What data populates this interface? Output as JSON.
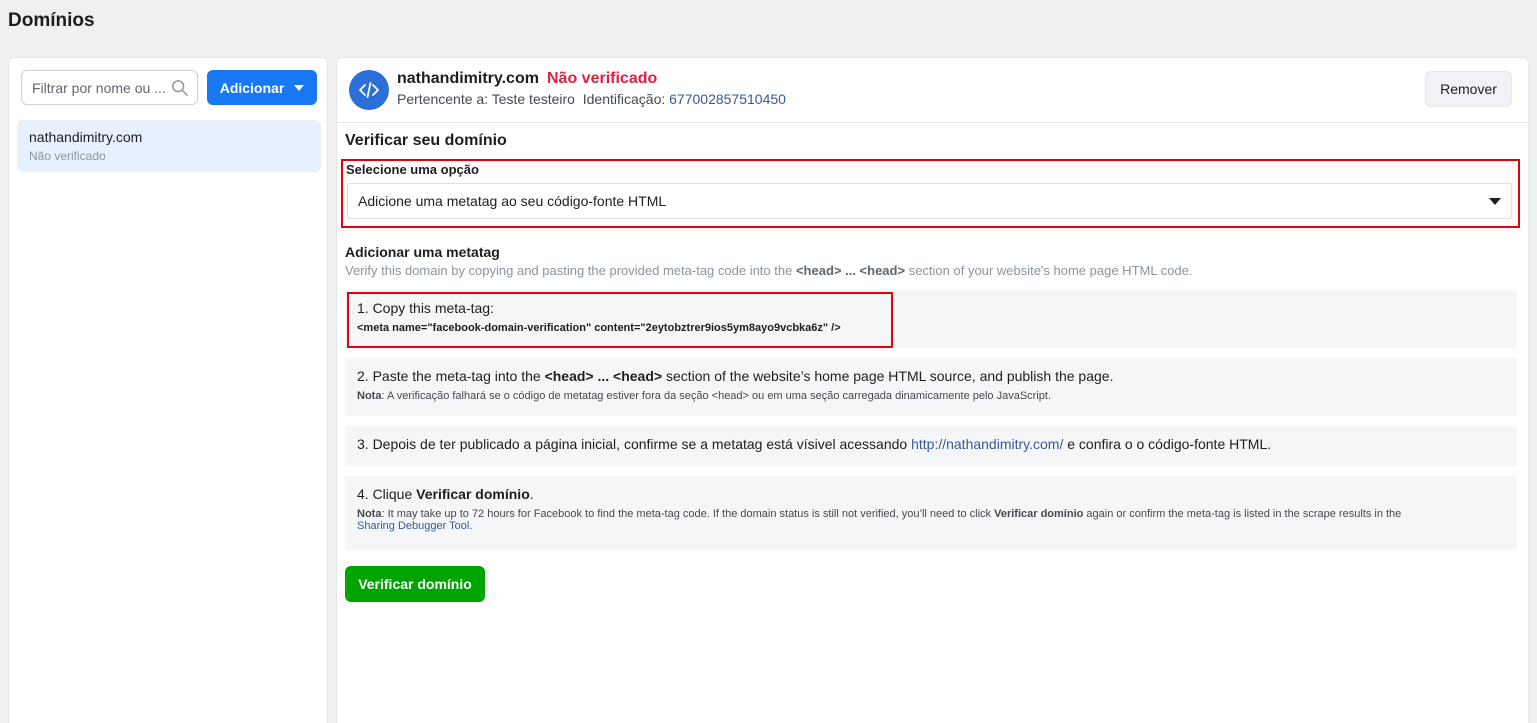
{
  "page": {
    "title": "Domínios"
  },
  "sidebar": {
    "search_placeholder": "Filtrar por nome ou ...",
    "add_label": "Adicionar",
    "items": [
      {
        "name": "nathandimitry.com",
        "status": "Não verificado"
      }
    ]
  },
  "detail": {
    "domain": "nathandimitry.com",
    "status": "Não verificado",
    "owner_label": "Pertencente a:",
    "owner": "Teste testeiro",
    "id_label": "Identificação:",
    "id": "677002857510450",
    "remove_label": "Remover",
    "verify_title": "Verificar seu domínio",
    "select_label": "Selecione uma opção",
    "select_value": "Adicione uma metatag ao seu código-fonte HTML",
    "meta_title": "Adicionar uma metatag",
    "meta_desc_prefix": "Verify this domain by copying and pasting the provided meta-tag code into the ",
    "meta_desc_tag": "<head> ... <head>",
    "meta_desc_suffix": " section of your website's home page HTML code.",
    "step1_text": "1. Copy this meta-tag:",
    "step1_code": "<meta name=\"facebook-domain-verification\" content=\"2eytobztrer9ios5ym8ayo9vcbka6z\" />",
    "step2_prefix": "2. Paste the meta-tag into the ",
    "step2_tag": "<head> ... <head>",
    "step2_suffix": " section of the website’s home page HTML source, and publish the page.",
    "step2_note_label": "Nota",
    "step2_note": ": A verificação falhará se o código de metatag estiver fora da seção <head> ou em uma seção carregada dinamicamente pelo JavaScript.",
    "step3_prefix": "3. Depois de ter publicado a página inicial, confirme se a metatag está vísivel acessando ",
    "step3_link": "http://nathandimitry.com/",
    "step3_suffix": " e confira o o código-fonte HTML.",
    "step4_prefix": "4. Clique ",
    "step4_bold": "Verificar domínio",
    "step4_suffix": ".",
    "step4_note_label": "Nota",
    "step4_note_a": ": It may take up to 72 hours for Facebook to find the meta-tag code. If the domain status is still not verified, you’ll need to click ",
    "step4_note_bold": "Verificar domínio",
    "step4_note_b": " again or confirm the meta-tag is listed in the scrape results in the",
    "step4_note_link": "Sharing Debugger Tool",
    "step4_note_c": ".",
    "verify_button": "Verificar domínio"
  },
  "colors": {
    "primary": "#1877f2",
    "danger": "#e41e3f",
    "success": "#00a400",
    "link": "#385898",
    "highlight_border": "#e5000f"
  },
  "icons": {
    "search": "search-icon",
    "dropdown": "caret-down-icon",
    "domain": "code-icon"
  }
}
